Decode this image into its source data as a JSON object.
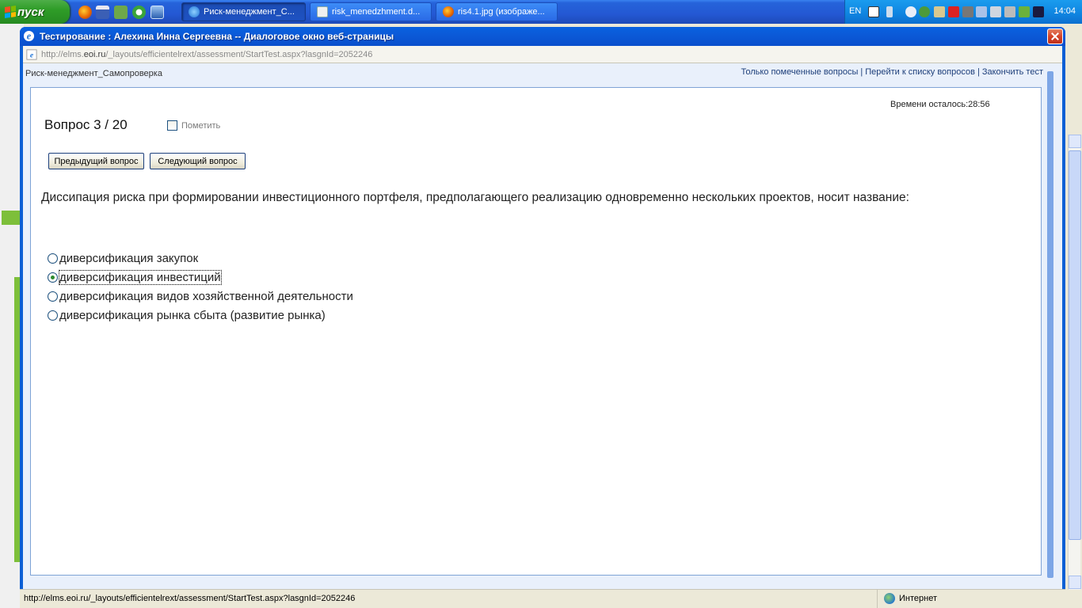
{
  "taskbar": {
    "start_label": "пуск",
    "tasks": [
      {
        "label": "Риск-менеджмент_С...",
        "active": true
      },
      {
        "label": "risk_menedzhment.d...",
        "active": false
      },
      {
        "label": "ris4.1.jpg (изображе...",
        "active": false
      }
    ],
    "language": "EN",
    "clock": "14:04"
  },
  "dialog": {
    "title": "Тестирование : Алехина Инна Сергеевна -- Диалоговое окно веб-страницы",
    "address": "http://elms.eoi.ru/_layouts/efficientelrext/assessment/StartTest.aspx?lasgnId=2052246",
    "address_host_bold": "eoi.ru"
  },
  "page": {
    "breadcrumb": "Риск-менеджмент_Самопроверка",
    "links": {
      "marked_only": "Только помеченные вопросы",
      "to_list": "Перейти к списку вопросов",
      "finish": "Закончить тест"
    },
    "timer": "Времени осталось:28:56",
    "question_number": "Вопрос 3 / 20",
    "mark_label": "Пометить",
    "mark_checked": false,
    "prev_button": "Предыдущий вопрос",
    "next_button": "Следующий вопрос",
    "question_text": "Диссипация риска при формировании инвестиционного портфеля, предполагающего реализацию одновременно нескольких проектов, носит название:",
    "answers": [
      {
        "label": "диверсификация закупок",
        "selected": false
      },
      {
        "label": "диверсификация инвестиций",
        "selected": true
      },
      {
        "label": "диверсификация видов хозяйственной деятельности",
        "selected": false
      },
      {
        "label": "диверсификация рынка сбыта (развитие рынка)",
        "selected": false
      }
    ]
  },
  "statusbar": {
    "url": "http://elms.eoi.ru/_layouts/efficientelrext/assessment/StartTest.aspx?lasgnId=2052246",
    "zone": "Интернет"
  }
}
